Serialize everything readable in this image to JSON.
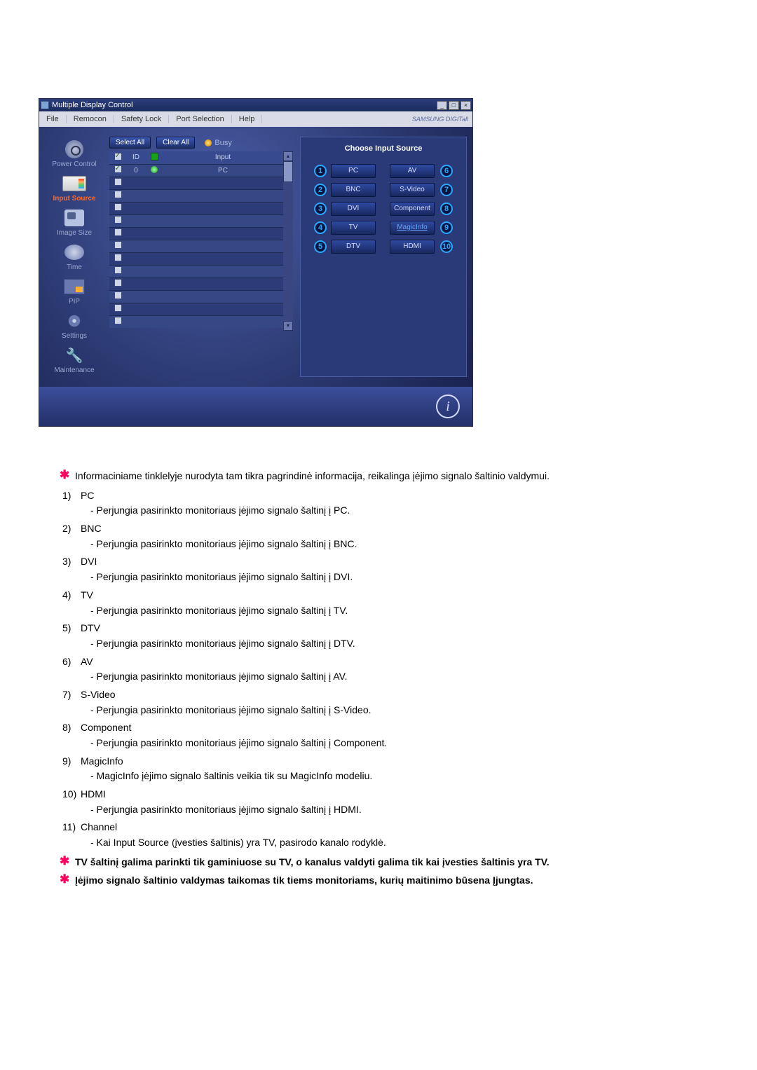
{
  "window": {
    "title": "Multiple Display Control",
    "menus": [
      "File",
      "Remocon",
      "Safety Lock",
      "Port Selection",
      "Help"
    ],
    "logo": "SAMSUNG DIGITall"
  },
  "sidebar": [
    {
      "label": "Power Control"
    },
    {
      "label": "Input Source"
    },
    {
      "label": "Image Size"
    },
    {
      "label": "Time"
    },
    {
      "label": "PIP"
    },
    {
      "label": "Settings"
    },
    {
      "label": "Maintenance"
    }
  ],
  "toolbar": {
    "select_all": "Select All",
    "clear_all": "Clear All",
    "busy": "Busy"
  },
  "table": {
    "headers": {
      "cb": "",
      "id": "ID",
      "status": "",
      "input": "Input"
    },
    "rows": [
      {
        "checked": true,
        "id": "0",
        "status": "on",
        "input": "PC"
      },
      {
        "checked": false
      },
      {
        "checked": false
      },
      {
        "checked": false
      },
      {
        "checked": false
      },
      {
        "checked": false
      },
      {
        "checked": false
      },
      {
        "checked": false
      },
      {
        "checked": false
      },
      {
        "checked": false
      },
      {
        "checked": false
      },
      {
        "checked": false
      },
      {
        "checked": false
      }
    ]
  },
  "source_panel": {
    "title": "Choose Input Source",
    "left": [
      {
        "n": "1",
        "label": "PC"
      },
      {
        "n": "2",
        "label": "BNC"
      },
      {
        "n": "3",
        "label": "DVI"
      },
      {
        "n": "4",
        "label": "TV"
      },
      {
        "n": "5",
        "label": "DTV"
      }
    ],
    "right": [
      {
        "n": "6",
        "label": "AV"
      },
      {
        "n": "7",
        "label": "S-Video"
      },
      {
        "n": "8",
        "label": "Component"
      },
      {
        "n": "9",
        "label": "MagicInfo",
        "magic": true
      },
      {
        "n": "10",
        "label": "HDMI"
      }
    ]
  },
  "notes": {
    "intro": "Informaciniame tinklelyje nurodyta tam tikra pagrindinė informacija, reikalinga įėjimo signalo šaltinio valdymui.",
    "items": [
      {
        "n": "1)",
        "title": "PC",
        "desc": "- Perjungia pasirinkto monitoriaus įėjimo signalo šaltinį į PC."
      },
      {
        "n": "2)",
        "title": "BNC",
        "desc": "- Perjungia pasirinkto monitoriaus įėjimo signalo šaltinį į BNC."
      },
      {
        "n": "3)",
        "title": "DVI",
        "desc": "- Perjungia pasirinkto monitoriaus įėjimo signalo šaltinį į DVI."
      },
      {
        "n": "4)",
        "title": "TV",
        "desc": "- Perjungia pasirinkto monitoriaus įėjimo signalo šaltinį į TV."
      },
      {
        "n": "5)",
        "title": "DTV",
        "desc": "- Perjungia pasirinkto monitoriaus įėjimo signalo šaltinį į DTV."
      },
      {
        "n": "6)",
        "title": "AV",
        "desc": "- Perjungia pasirinkto monitoriaus įėjimo signalo šaltinį į AV."
      },
      {
        "n": "7)",
        "title": "S-Video",
        "desc": "- Perjungia pasirinkto monitoriaus įėjimo signalo šaltinį į S-Video."
      },
      {
        "n": "8)",
        "title": "Component",
        "desc": "- Perjungia pasirinkto monitoriaus įėjimo signalo šaltinį į Component."
      },
      {
        "n": "9)",
        "title": "MagicInfo",
        "desc": "- MagicInfo įėjimo signalo šaltinis veikia tik su MagicInfo modeliu."
      },
      {
        "n": "10)",
        "title": "HDMI",
        "desc": "- Perjungia pasirinkto monitoriaus įėjimo signalo šaltinį į HDMI."
      },
      {
        "n": "11)",
        "title": "Channel",
        "desc": "- Kai Input Source (įvesties šaltinis) yra TV, pasirodo kanalo rodyklė."
      }
    ],
    "footer1": "TV šaltinį galima parinkti tik gaminiuose su TV, o kanalus valdyti galima tik kai įvesties šaltinis yra TV.",
    "footer2": "Įėjimo signalo šaltinio valdymas taikomas tik tiems monitoriams, kurių maitinimo būsena Įjungtas."
  }
}
